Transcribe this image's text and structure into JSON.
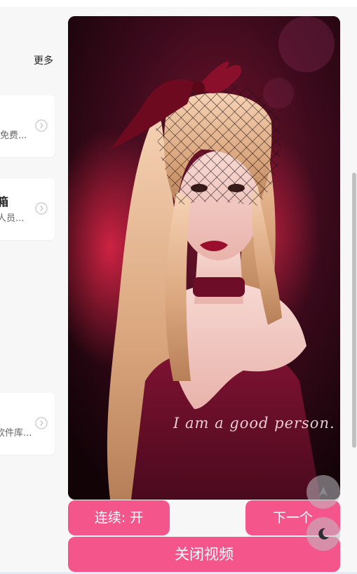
{
  "header": {
    "more_label": "更多"
  },
  "cards": [
    {
      "title": "",
      "desc": "免费..."
    },
    {
      "title": "箱",
      "desc": "人员..."
    },
    {
      "title": "",
      "desc": "软件库..."
    }
  ],
  "video": {
    "caption": "I am a good person."
  },
  "controls": {
    "continuous_label": "连续: 开",
    "next_label": "下一个",
    "close_label": "关闭视频"
  },
  "colors": {
    "accent": "#f4558b",
    "background": "#f7f7f8"
  },
  "icons": {
    "card_arrow": "chevron-right-circle-icon",
    "scroll_top": "arrow-up-icon",
    "theme_toggle": "moon-icon"
  }
}
